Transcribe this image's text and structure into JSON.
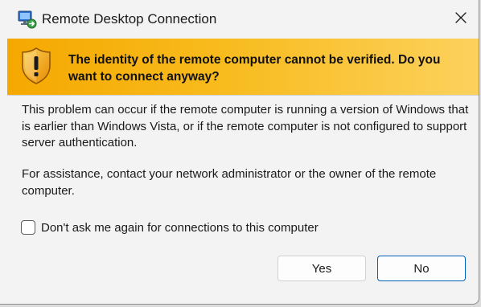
{
  "window": {
    "title": "Remote Desktop Connection",
    "app_icon": "remote-desktop-icon",
    "close_icon": "close-icon"
  },
  "banner": {
    "icon": "shield-warning-icon",
    "message": "The identity of the remote computer cannot be verified. Do you want to connect anyway?",
    "gradient_colors": [
      "#f5a800",
      "#fcd15c"
    ]
  },
  "body": {
    "paragraph1": "This problem can occur if the remote computer is running a version of Windows that is earlier than Windows Vista, or if the remote computer is not configured to support server authentication.",
    "paragraph2": "For assistance, contact your network administrator or the owner of the remote computer."
  },
  "checkbox": {
    "label": "Don't ask me again for connections to this computer",
    "checked": false
  },
  "buttons": {
    "yes_label": "Yes",
    "no_label": "No",
    "default_button": "No",
    "focus_color": "#005fb8"
  }
}
